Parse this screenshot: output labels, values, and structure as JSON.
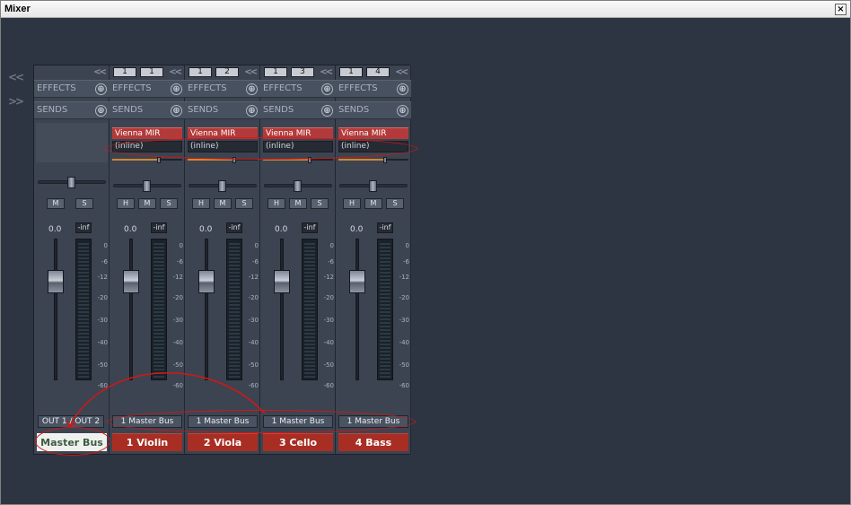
{
  "window": {
    "title": "Mixer",
    "close_glyph": "×"
  },
  "nav": {
    "collapse_glyph": "<<",
    "expand_glyph": ">>"
  },
  "labels": {
    "effects": "EFFECTS",
    "sends": "SENDS",
    "add_glyph": "⊕",
    "collapse_glyph": "<<"
  },
  "master": {
    "volume": "0.0",
    "peak": "-inf",
    "mute": "M",
    "solo": "S",
    "output": "OUT 1 / OUT 2",
    "name": "Master Bus",
    "scale": [
      "0",
      "-6",
      "-12",
      "-20",
      "-30",
      "-40",
      "-50",
      "-60"
    ]
  },
  "channels": [
    {
      "route_a": "1",
      "route_b": "1",
      "insert": "Vienna MIR",
      "insert_mode": "(inline)",
      "hide": "H",
      "mute": "M",
      "solo": "S",
      "volume": "0.0",
      "peak": "-inf",
      "output": "1 Master Bus",
      "name": "1 Violin"
    },
    {
      "route_a": "1",
      "route_b": "2",
      "insert": "Vienna MIR",
      "insert_mode": "(inline)",
      "hide": "H",
      "mute": "M",
      "solo": "S",
      "volume": "0.0",
      "peak": "-inf",
      "output": "1 Master Bus",
      "name": "2 Viola"
    },
    {
      "route_a": "1",
      "route_b": "3",
      "insert": "Vienna MIR",
      "insert_mode": "(inline)",
      "hide": "H",
      "mute": "M",
      "solo": "S",
      "volume": "0.0",
      "peak": "-inf",
      "output": "1 Master Bus",
      "name": "3 Cello"
    },
    {
      "route_a": "1",
      "route_b": "4",
      "insert": "Vienna MIR",
      "insert_mode": "(inline)",
      "hide": "H",
      "mute": "M",
      "solo": "S",
      "volume": "0.0",
      "peak": "-inf",
      "output": "1 Master Bus",
      "name": "4 Bass"
    }
  ],
  "colors": {
    "insert_red": "#b33a3a",
    "name_red": "#a82e24",
    "annotation_red": "#d41616",
    "send_orange": "#d2882e"
  }
}
